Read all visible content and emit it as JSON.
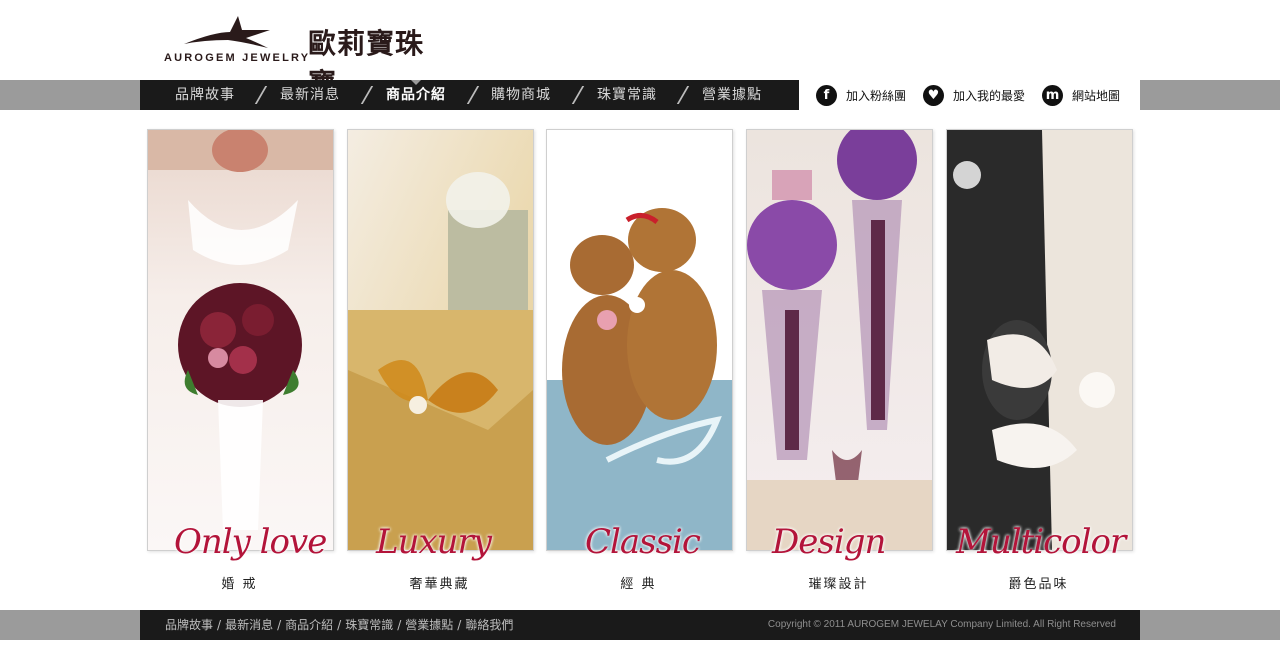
{
  "brand": {
    "name_en": "AUROGEM JEWELRY",
    "name_cn": "歐莉寶珠寶"
  },
  "nav": {
    "items": [
      {
        "label": "品牌故事",
        "active": false
      },
      {
        "label": "最新消息",
        "active": false
      },
      {
        "label": "商品介紹",
        "active": true
      },
      {
        "label": "購物商城",
        "active": false
      },
      {
        "label": "珠寶常識",
        "active": false
      },
      {
        "label": "營業據點",
        "active": false
      }
    ]
  },
  "utility": {
    "items": [
      {
        "icon": "facebook-icon",
        "glyph": "f",
        "label": "加入粉絲團"
      },
      {
        "icon": "heart-icon",
        "glyph": "♥",
        "label": "加入我的最愛"
      },
      {
        "icon": "sitemap-icon",
        "glyph": "m",
        "label": "網站地圖"
      }
    ]
  },
  "panels": [
    {
      "script": "Only love",
      "subtitle": "婚 戒",
      "image": "bride-bouquet-image"
    },
    {
      "script": "Luxury",
      "subtitle": "奢華典藏",
      "image": "gift-box-image"
    },
    {
      "script": "Classic",
      "subtitle": "經 典",
      "image": "teddy-bears-image"
    },
    {
      "script": "Design",
      "subtitle": "璀璨設計",
      "image": "flower-vases-image"
    },
    {
      "script": "Multicolor",
      "subtitle": "爵色品味",
      "image": "couple-gloves-image"
    }
  ],
  "footer": {
    "links": [
      "品牌故事",
      "最新消息",
      "商品介紹",
      "珠寶常識",
      "營業據點",
      "聯絡我們"
    ],
    "separator": "/",
    "copyright": "Copyright © 2011 AUROGEM JEWELAY Company Limited. All Right Reserved"
  },
  "colors": {
    "script_red": "#b3143a",
    "nav_bg": "#1a1a1a",
    "band_grey": "#9b9b9b"
  }
}
